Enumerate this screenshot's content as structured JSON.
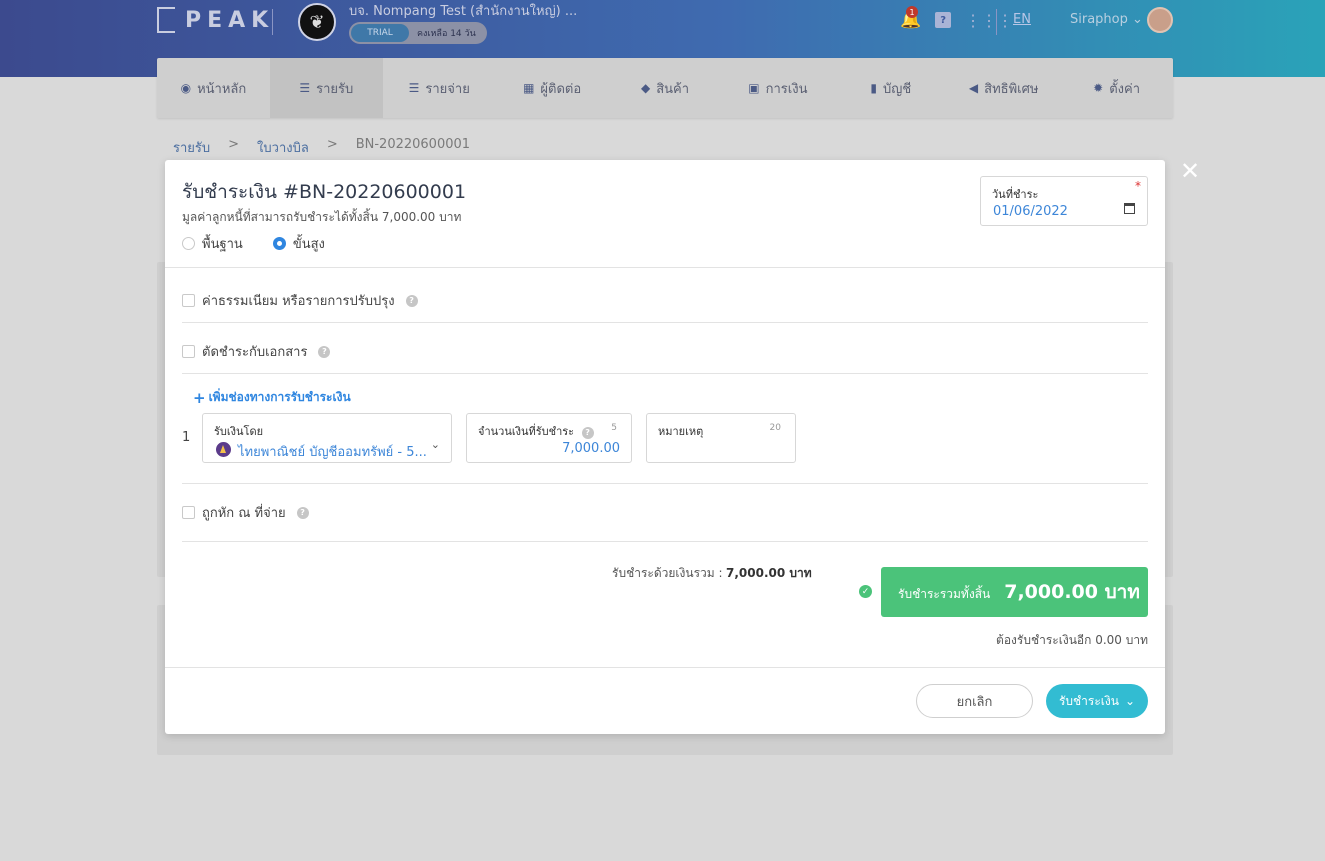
{
  "app": {
    "logo": "PEAK",
    "company_name": "บจ. Nompang Test (สำนักงานใหญ่) ...",
    "trial_badge": "TRIAL",
    "trial_days": "คงเหลือ 14 วัน",
    "notification_count": "1",
    "language": "EN",
    "username": "Siraphop"
  },
  "nav": {
    "items": [
      {
        "label": "หน้าหลัก",
        "icon": "dashboard-icon"
      },
      {
        "label": "รายรับ",
        "icon": "income-icon"
      },
      {
        "label": "รายจ่าย",
        "icon": "expense-icon"
      },
      {
        "label": "ผู้ติดต่อ",
        "icon": "contacts-icon"
      },
      {
        "label": "สินค้า",
        "icon": "box-icon"
      },
      {
        "label": "การเงิน",
        "icon": "money-icon"
      },
      {
        "label": "บัญชี",
        "icon": "book-icon"
      },
      {
        "label": "สิทธิพิเศษ",
        "icon": "megaphone-icon"
      },
      {
        "label": "ตั้งค่า",
        "icon": "gear-icon"
      }
    ],
    "active_index": 1
  },
  "breadcrumb": {
    "items": [
      "รายรับ",
      "ใบวางบิล",
      "BN-20220600001"
    ],
    "separator": ">"
  },
  "modal": {
    "title": "รับชำระเงิน #BN-20220600001",
    "subtitle": "มูลค่าลูกหนี้ที่สามารถรับชำระได้ทั้งสิ้น 7,000.00 บาท",
    "mode_basic": "พื้นฐาน",
    "mode_advanced": "ขั้นสูง",
    "selected_mode": "advanced",
    "date": {
      "label": "วันที่ชำระ",
      "required_mark": "*",
      "value": "01/06/2022"
    },
    "fee_checkbox": "ค่าธรรมเนียม หรือรายการปรับปรุง",
    "offset_checkbox": "ตัดชำระกับเอกสาร",
    "add_channel": "เพิ่มช่องทางการรับชำระเงิน",
    "payment_row": {
      "number": "1",
      "method_label": "รับเงินโดย",
      "method_value": "ไทยพาณิชย์ บัญชีออมทรัพย์ - 5...",
      "amount_label": "จำนวนเงินที่รับชำระ",
      "amount_count": "5",
      "amount_value": "7,000.00",
      "note_label": "หมายเหตุ",
      "note_count": "20",
      "note_value": ""
    },
    "withholding_checkbox": "ถูกหัก ณ ที่จ่าย",
    "total_cash_label": "รับชำระด้วยเงินรวม :",
    "total_cash_value": "7,000.00 บาท",
    "grand_label": "รับชำระรวมทั้งสิ้น",
    "grand_value": "7,000.00 บาท",
    "remaining": "ต้องรับชำระเงินอีก 0.00 บาท",
    "cancel_button": "ยกเลิก",
    "submit_button": "รับชำระเงิน"
  },
  "colors": {
    "primary": "#2f86e0",
    "success": "#4bc37a",
    "submit": "#32bcd2"
  }
}
